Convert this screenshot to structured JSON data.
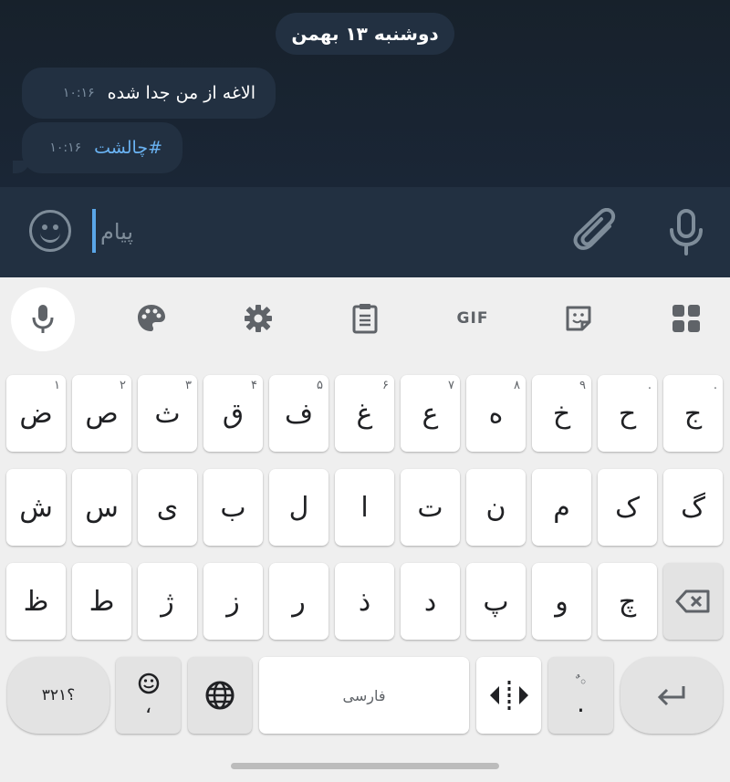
{
  "chat": {
    "date": "دوشنبه ۱۳ بهمن",
    "messages": [
      {
        "text": "الاغه از من جدا شده",
        "time": "۱۰:۱۶"
      },
      {
        "text": "#چالشت",
        "time": "۱۰:۱۶"
      }
    ]
  },
  "composer": {
    "placeholder": "پیام",
    "value": "",
    "icons": {
      "emoji": "emoji-icon",
      "attach": "paperclip-icon",
      "mic": "microphone-icon"
    }
  },
  "keyboard_toolbar": [
    "microphone-icon",
    "palette-icon",
    "gear-icon",
    "clipboard-icon",
    "GIF",
    "sticker-icon",
    "grid-icon"
  ],
  "gif_label": "GIF",
  "keys": {
    "row1": [
      {
        "label": "ج",
        "hint": "."
      },
      {
        "label": "ح",
        "hint": "."
      },
      {
        "label": "خ",
        "hint": "۹"
      },
      {
        "label": "ه",
        "hint": "۸"
      },
      {
        "label": "ع",
        "hint": "۷"
      },
      {
        "label": "غ",
        "hint": "۶"
      },
      {
        "label": "ف",
        "hint": "۵"
      },
      {
        "label": "ق",
        "hint": "۴"
      },
      {
        "label": "ث",
        "hint": "۳"
      },
      {
        "label": "ص",
        "hint": "۲"
      },
      {
        "label": "ض",
        "hint": "۱"
      }
    ],
    "row2": [
      "گ",
      "ک",
      "م",
      "ن",
      "ت",
      "ا",
      "ل",
      "ب",
      "ی",
      "س",
      "ش"
    ],
    "row3": [
      "چ",
      "و",
      "پ",
      "د",
      "ذ",
      "ر",
      "ز",
      "ژ",
      "ط",
      "ظ"
    ],
    "bottom": {
      "symbols": "؟۳۲۱",
      "comma": "،",
      "space": "فارسی",
      "period": "."
    }
  },
  "colors": {
    "chat_bg": "#17212b",
    "bubble": "#223041",
    "link": "#6ab3f3",
    "keyboard_bg": "#efefef"
  }
}
